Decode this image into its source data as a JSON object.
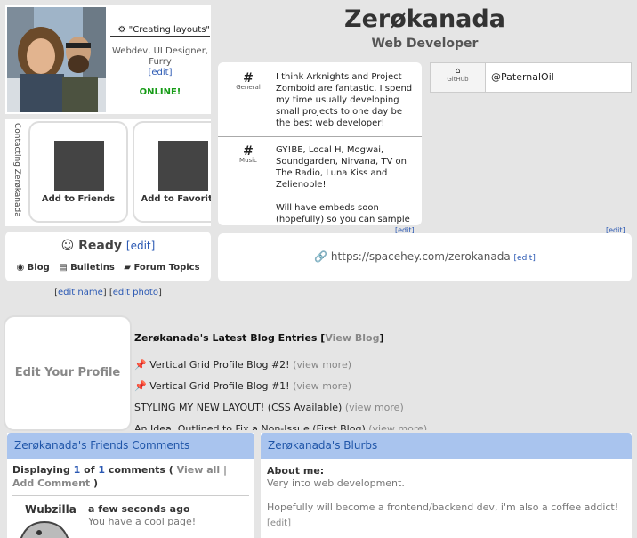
{
  "profile": {
    "display_name": "Zerøkanada",
    "subtitle": "Web Developer",
    "mood": "\"Creating layouts\"",
    "bio_line1": "Webdev, UI Designer,",
    "bio_line2": "Furry",
    "bio_edit": "[edit]",
    "status": "ONLINE!"
  },
  "contact": {
    "vertical_label": "Contacting Zerøkanada",
    "add_friends": "Add to Friends",
    "add_favorites": "Add to Favorites"
  },
  "ready": {
    "label": "Ready",
    "edit": "[edit]",
    "links": [
      "Blog",
      "Bulletins",
      "Forum Topics"
    ]
  },
  "edit_links": {
    "edit_name": "edit name",
    "edit_photo": "edit photo"
  },
  "interests": [
    {
      "tag": "General",
      "text": "I think Arknights and Project Zomboid are fantastic. I spend my time usually developing small projects to one day be the best web developer!"
    },
    {
      "tag": "Music",
      "text": "GY!BE, Local H, Mogwai, Soundgarden, Nirvana, TV on The Radio, Luna Kiss and Zelienople!",
      "text2": "Will have embeds soon (hopefully) so you can sample"
    }
  ],
  "interests_edit": "[edit]",
  "github": {
    "tag": "GitHub",
    "handle": "@PaternalOil",
    "edit": "[edit]"
  },
  "url": {
    "text": "https://spacehey.com/zerokanada",
    "edit": "[edit]"
  },
  "edit_profile": "Edit Your Profile",
  "blog": {
    "title_prefix": "Zerøkanada's Latest Blog Entries [",
    "view_blog": "View Blog",
    "title_suffix": "]",
    "entries": [
      {
        "title": "Vertical Grid Profile Blog #2!",
        "more": "(view more)",
        "pinned": true
      },
      {
        "title": "Vertical Grid Profile Blog #1!",
        "more": "(view more)",
        "pinned": true
      },
      {
        "title": "STYLING MY NEW LAYOUT! (CSS Available)",
        "more": "(view more)",
        "pinned": false
      },
      {
        "title": "An Idea, Outlined to Fix a Non-Issue (First Blog)",
        "more": "(view more)",
        "pinned": false
      }
    ]
  },
  "comments": {
    "header": "Zerøkanada's Friends Comments",
    "displaying": "Displaying",
    "count_shown": "1",
    "of": "of",
    "count_total": "1",
    "comments_word": "comments (",
    "view_all": "View all",
    "separator": "|",
    "add": "Add Comment",
    "close": ")",
    "entry": {
      "author": "Wubzilla",
      "time": "a few seconds ago",
      "text": "You have a cool page!"
    }
  },
  "blurbs": {
    "header": "Zerøkanada's Blurbs",
    "about_label": "About me:",
    "line1": "Very into web development.",
    "line2": "Hopefully will become a frontend/backend dev, i'm also a coffee addict!",
    "edit": "[edit]"
  }
}
